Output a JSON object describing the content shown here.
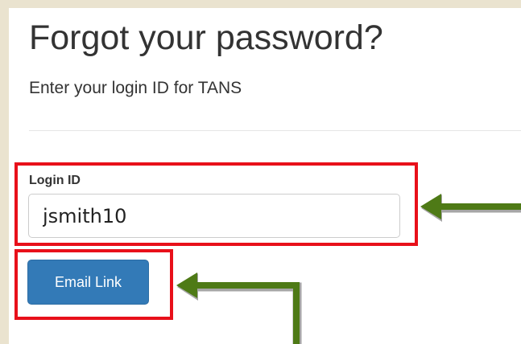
{
  "page": {
    "title": "Forgot your password?",
    "subtitle": "Enter your login ID for TANS"
  },
  "form": {
    "login_label": "Login ID",
    "login_value": "jsmith10",
    "submit_label": "Email Link"
  },
  "annotations": {
    "highlight_color": "#e8101a",
    "arrow_color": "#4e7a16",
    "highlights": [
      "login-id-field",
      "email-link-button"
    ],
    "arrows_point_to": [
      "login-id-field",
      "email-link-button"
    ]
  },
  "colors": {
    "background": "#eae3cf",
    "panel": "#ffffff",
    "primary_button": "#337ab7",
    "text": "#333333"
  }
}
